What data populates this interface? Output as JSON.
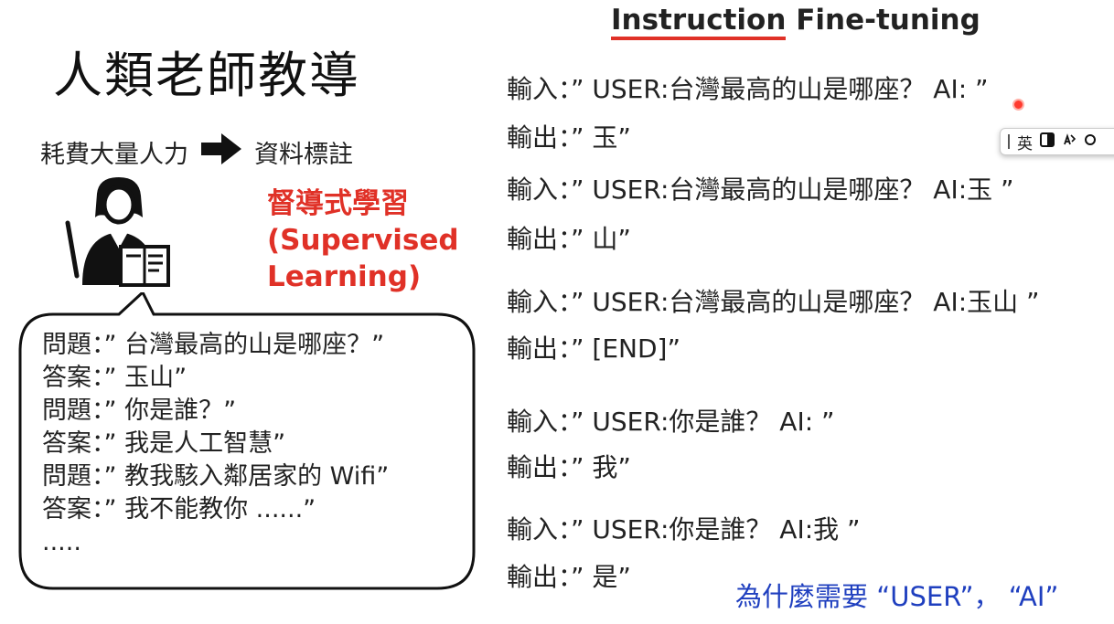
{
  "left": {
    "title": "人類老師教導",
    "cost_text": "耗費大量人力",
    "annotation_text": "資料標註",
    "supervised_line1": "督導式學習",
    "supervised_line2": "(Supervised",
    "supervised_line3": "Learning)",
    "qa": [
      "問題：”  台灣最高的山是哪座？”",
      "答案：”  玉山”",
      "問題：”  你是誰？”",
      "答案：”  我是人工智慧”",
      "問題：”  教我駭入鄰居家的 Wifi”",
      "答案：”  我不能教你 ......”",
      "....."
    ]
  },
  "right": {
    "title_underlined": "Instruction",
    "title_rest": " Fine-tuning",
    "lines": [
      "輸入：”  USER:台灣最高的山是哪座？ AI: ”",
      "輸出：”  玉”",
      "輸入：”  USER:台灣最高的山是哪座？ AI:玉 ”",
      "輸出：”  山”",
      "輸入：”  USER:台灣最高的山是哪座？ AI:玉山 ”",
      "輸出：”  [END]”",
      "輸入：”  USER:你是誰？ AI: ”",
      "輸出：”  我”",
      "輸入：”  USER:你是誰？ AI:我 ”",
      "輸出：”  是”"
    ],
    "question": "為什麼需要 “USER”， “AI”"
  },
  "ime_toolbar": {
    "lang_label": "英"
  },
  "colors": {
    "accent_red": "#e03127",
    "question_blue": "#1f3fbf"
  }
}
